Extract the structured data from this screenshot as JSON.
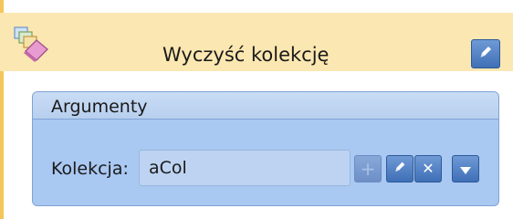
{
  "activity": {
    "title": "Wyczyść kolekcję",
    "icon": "clear-collection-eraser-icon",
    "colors": {
      "header": "#fbe7b1",
      "accent": "#f4c65a"
    }
  },
  "arguments_panel": {
    "title": "Argumenty",
    "collection": {
      "label": "Kolekcja:",
      "value": "aCol"
    },
    "buttons": [
      {
        "icon": "plus-icon",
        "enabled": false
      },
      {
        "icon": "pencil-icon",
        "enabled": true
      },
      {
        "icon": "close-icon",
        "enabled": true
      },
      {
        "icon": "dropdown-arrow-icon",
        "enabled": true
      }
    ],
    "colors": {
      "panel": "#a9c8f2",
      "border": "#7fa3d4"
    }
  }
}
